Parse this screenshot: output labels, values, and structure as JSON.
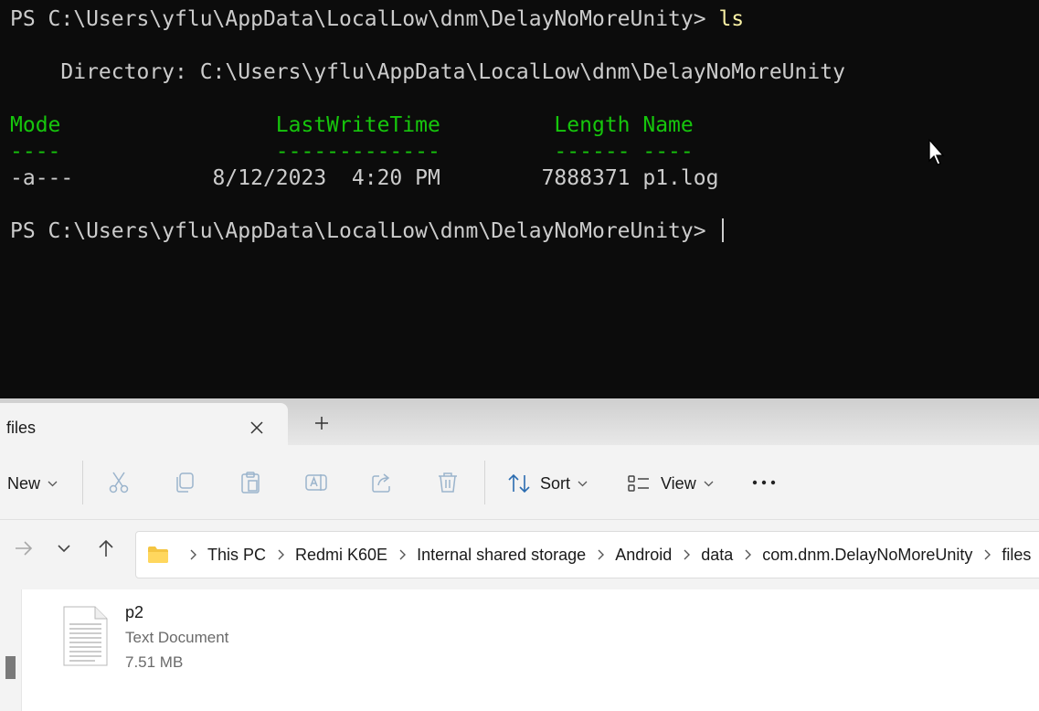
{
  "terminal": {
    "prompt1": "PS C:\\Users\\yflu\\AppData\\LocalLow\\dnm\\DelayNoMoreUnity> ",
    "command": "ls",
    "directory_line": "    Directory: C:\\Users\\yflu\\AppData\\LocalLow\\dnm\\DelayNoMoreUnity",
    "header_line": "Mode                 LastWriteTime         Length Name",
    "underline_line": "----                 -------------         ------ ----",
    "rows": [
      "-a---           8/12/2023  4:20 PM        7888371 p1.log"
    ],
    "prompt2": "PS C:\\Users\\yflu\\AppData\\LocalLow\\dnm\\DelayNoMoreUnity> "
  },
  "explorer": {
    "tab_title": "files",
    "toolbar": {
      "new_label": "New",
      "sort_label": "Sort",
      "view_label": "View"
    },
    "breadcrumbs": [
      "This PC",
      "Redmi K60E",
      "Internal shared storage",
      "Android",
      "data",
      "com.dnm.DelayNoMoreUnity",
      "files"
    ],
    "files": [
      {
        "name": "p2",
        "type": "Text Document",
        "size": "7.51 MB"
      }
    ]
  },
  "colors": {
    "terminal_bg": "#0c0c0c",
    "terminal_text": "#cccccc",
    "terminal_command": "#f9f1a5",
    "terminal_header": "#16c60c",
    "explorer_bg": "#f3f3f3",
    "accent_blue": "#2b6cb0"
  }
}
